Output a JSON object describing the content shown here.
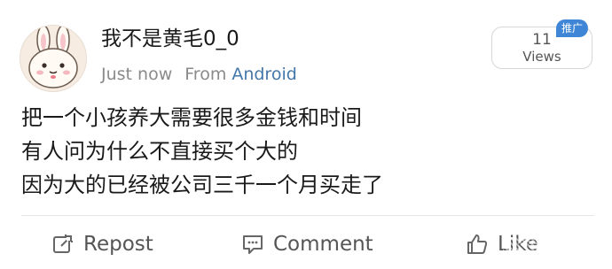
{
  "user": {
    "name": "我不是黄毛0_0"
  },
  "meta": {
    "time": "Just now",
    "source_prefix": "From",
    "source_app": "Android"
  },
  "views": {
    "count": "11",
    "label": "Views",
    "badge": "推广"
  },
  "post": {
    "lines": [
      "把一个小孩养大需要很多金钱和时间",
      "有人问为什么不直接买个大的",
      "因为大的已经被公司三千一个月买走了"
    ]
  },
  "actions": {
    "repost": "Repost",
    "comment": "Comment",
    "like": "Like"
  },
  "colors": {
    "link": "#4477aa",
    "badge": "#3f86d6",
    "muted": "#8a8a8a"
  }
}
